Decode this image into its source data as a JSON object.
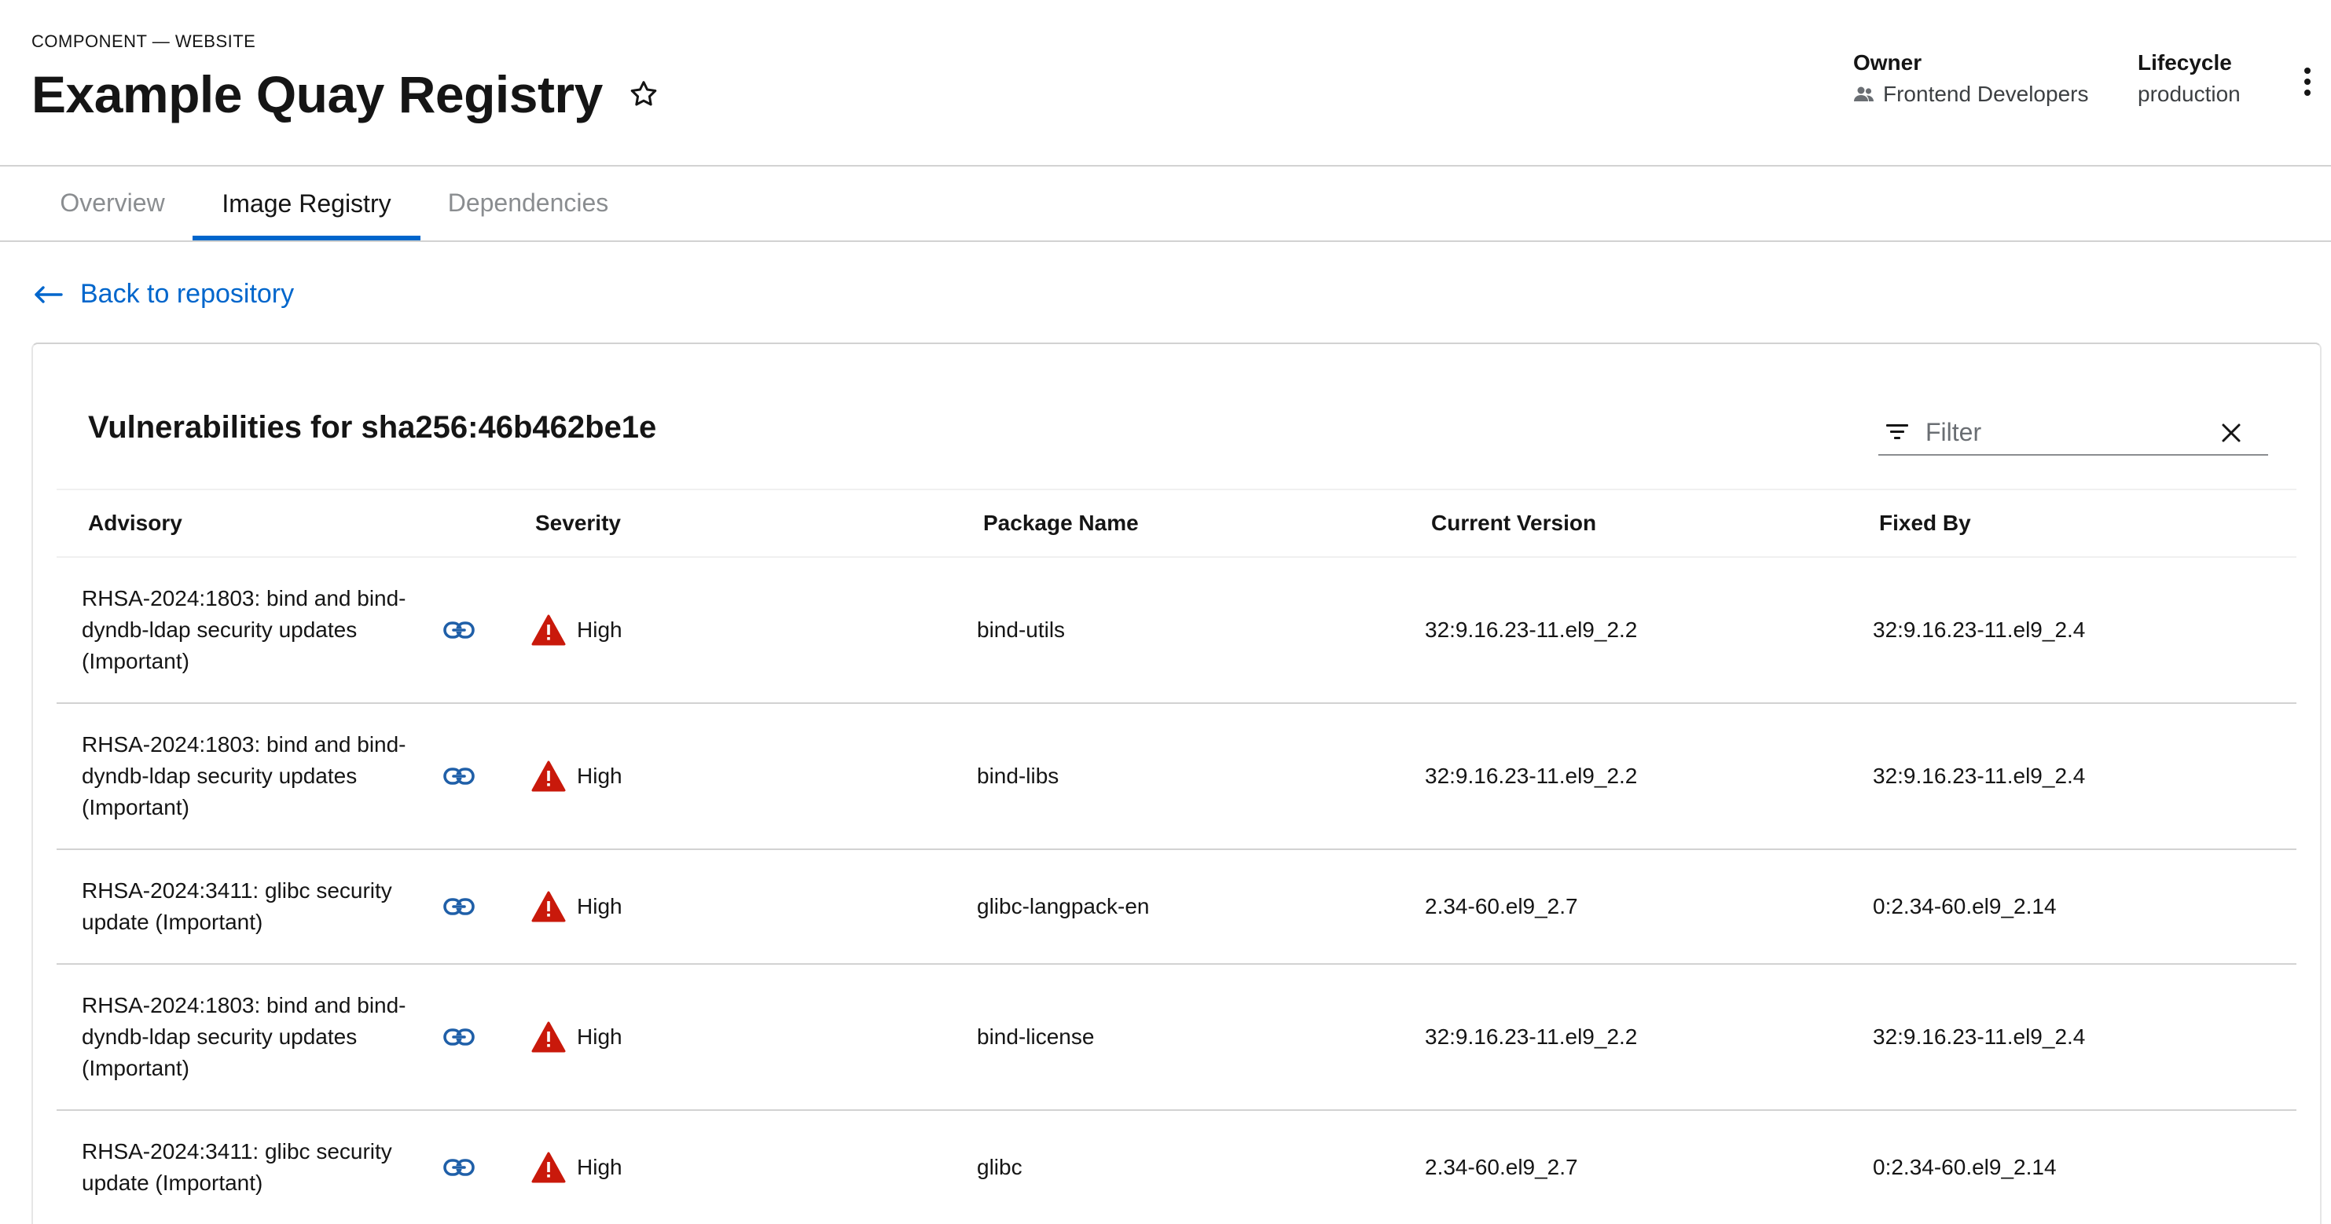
{
  "header": {
    "eyebrow": "COMPONENT — WEBSITE",
    "title": "Example Quay Registry",
    "owner_label": "Owner",
    "owner_value": "Frontend Developers",
    "lifecycle_label": "Lifecycle",
    "lifecycle_value": "production"
  },
  "tabs": [
    {
      "label": "Overview",
      "active": false
    },
    {
      "label": "Image Registry",
      "active": true
    },
    {
      "label": "Dependencies",
      "active": false
    }
  ],
  "back_link": "Back to repository",
  "card": {
    "title": "Vulnerabilities for sha256:46b462be1e",
    "filter_placeholder": "Filter"
  },
  "table": {
    "columns": [
      "Advisory",
      "Severity",
      "Package Name",
      "Current Version",
      "Fixed By"
    ],
    "rows": [
      {
        "advisory": "RHSA-2024:1803: bind and bind-dyndb-ldap security updates (Important)",
        "severity": "High",
        "package": "bind-utils",
        "current": "32:9.16.23-11.el9_2.2",
        "fixed": "32:9.16.23-11.el9_2.4"
      },
      {
        "advisory": "RHSA-2024:1803: bind and bind-dyndb-ldap security updates (Important)",
        "severity": "High",
        "package": "bind-libs",
        "current": "32:9.16.23-11.el9_2.2",
        "fixed": "32:9.16.23-11.el9_2.4"
      },
      {
        "advisory": "RHSA-2024:3411: glibc security update (Important)",
        "severity": "High",
        "package": "glibc-langpack-en",
        "current": "2.34-60.el9_2.7",
        "fixed": "0:2.34-60.el9_2.14"
      },
      {
        "advisory": "RHSA-2024:1803: bind and bind-dyndb-ldap security updates (Important)",
        "severity": "High",
        "package": "bind-license",
        "current": "32:9.16.23-11.el9_2.2",
        "fixed": "32:9.16.23-11.el9_2.4"
      },
      {
        "advisory": "RHSA-2024:3411: glibc security update (Important)",
        "severity": "High",
        "package": "glibc",
        "current": "2.34-60.el9_2.7",
        "fixed": "0:2.34-60.el9_2.14"
      }
    ]
  },
  "colors": {
    "accent": "#0066cc",
    "severity_high": "#c9190b",
    "text": "#151515",
    "muted": "#8a8d90",
    "border": "#d2d2d2"
  },
  "icons": {
    "favorite": "star-outline-icon",
    "owner": "group-icon",
    "menu": "kebab-icon",
    "back": "arrow-left-icon",
    "filter": "filter-icon",
    "clear": "close-icon",
    "advisory_link": "link-icon",
    "severity": "warning-triangle-icon"
  }
}
